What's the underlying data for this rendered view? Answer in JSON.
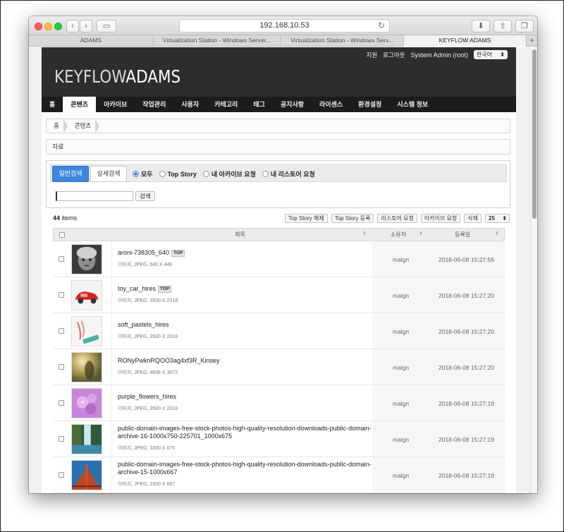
{
  "browser": {
    "address": "192.168.10.53",
    "tabs": [
      {
        "label": "ADAMS",
        "active": false
      },
      {
        "label": "Virtualization Station - Windows Server...",
        "active": false
      },
      {
        "label": "Virtualization Station - Windows Serv...",
        "active": false
      },
      {
        "label": "KEYFLOW ADAMS",
        "active": true
      }
    ],
    "add_tab": "+"
  },
  "util": {
    "support": "지원",
    "logout": "로그아웃",
    "user": "System Admin (root)",
    "language": "한국어"
  },
  "logo": {
    "part1": "KEYFLOW",
    "part2": "ADAMS"
  },
  "nav": [
    "홈",
    "콘텐츠",
    "아카이브",
    "작업관리",
    "사용자",
    "카테고리",
    "태그",
    "공지사항",
    "라이센스",
    "환경설정",
    "시스템 정보"
  ],
  "breadcrumb": [
    "홈",
    "콘텐츠"
  ],
  "section_title": "자료",
  "search": {
    "tab_basic": "일반검색",
    "tab_detail": "상세검색",
    "radios": [
      "모두",
      "Top Story",
      "내 아카이브 요청",
      "내 리스토어 요청"
    ],
    "button": "검색",
    "input_value": ""
  },
  "list": {
    "count": "44",
    "count_suffix": " items",
    "actions": [
      "Top Story 해제",
      "Top Story 등록",
      "리스토어 요청",
      "아카이브 요청",
      "삭제"
    ],
    "per_page": "25",
    "columns": {
      "title": "제목",
      "owner": "소유자",
      "date": "등록일"
    },
    "rows": [
      {
        "title": "aroni-738305_640",
        "top": "TOP",
        "meta": "이미지, JPEG, 640 X 446",
        "owner": "malgn",
        "date": "2018-06-08 15:27:56"
      },
      {
        "title": "toy_car_hires",
        "top": "TOP",
        "meta": "이미지, JPEG, 3500 X 2318",
        "owner": "malgn",
        "date": "2018-06-08 15:27:20"
      },
      {
        "title": "soft_pastels_hires",
        "top": "",
        "meta": "이미지, JPEG, 3500 X 2318",
        "owner": "malgn",
        "date": "2018-06-08 15:27:20"
      },
      {
        "title": "RONyPwknRQOO3ag4xf3R_Kinsey",
        "top": "",
        "meta": "이미지, JPEG, 4608 X 3072",
        "owner": "malgn",
        "date": "2018-06-08 15:27:20"
      },
      {
        "title": "purple_flowers_hires",
        "top": "",
        "meta": "이미지, JPEG, 3500 X 2318",
        "owner": "malgn",
        "date": "2018-06-08 15:27:19"
      },
      {
        "title": "public-domain-images-free-stock-photos-high-quality-resolution-downloads-public-domain-archive-16-1000x750-225701_1000x675",
        "top": "",
        "meta": "이미지, JPEG, 1000 X 675",
        "owner": "malgn",
        "date": "2018-06-08 15:27:19"
      },
      {
        "title": "public-domain-images-free-stock-photos-high-quality-resolution-downloads-public-domain-archive-15-1000x667",
        "top": "",
        "meta": "이미지, JPEG, 1000 X 667",
        "owner": "malgn",
        "date": "2018-06-08 15:27:19"
      }
    ]
  }
}
